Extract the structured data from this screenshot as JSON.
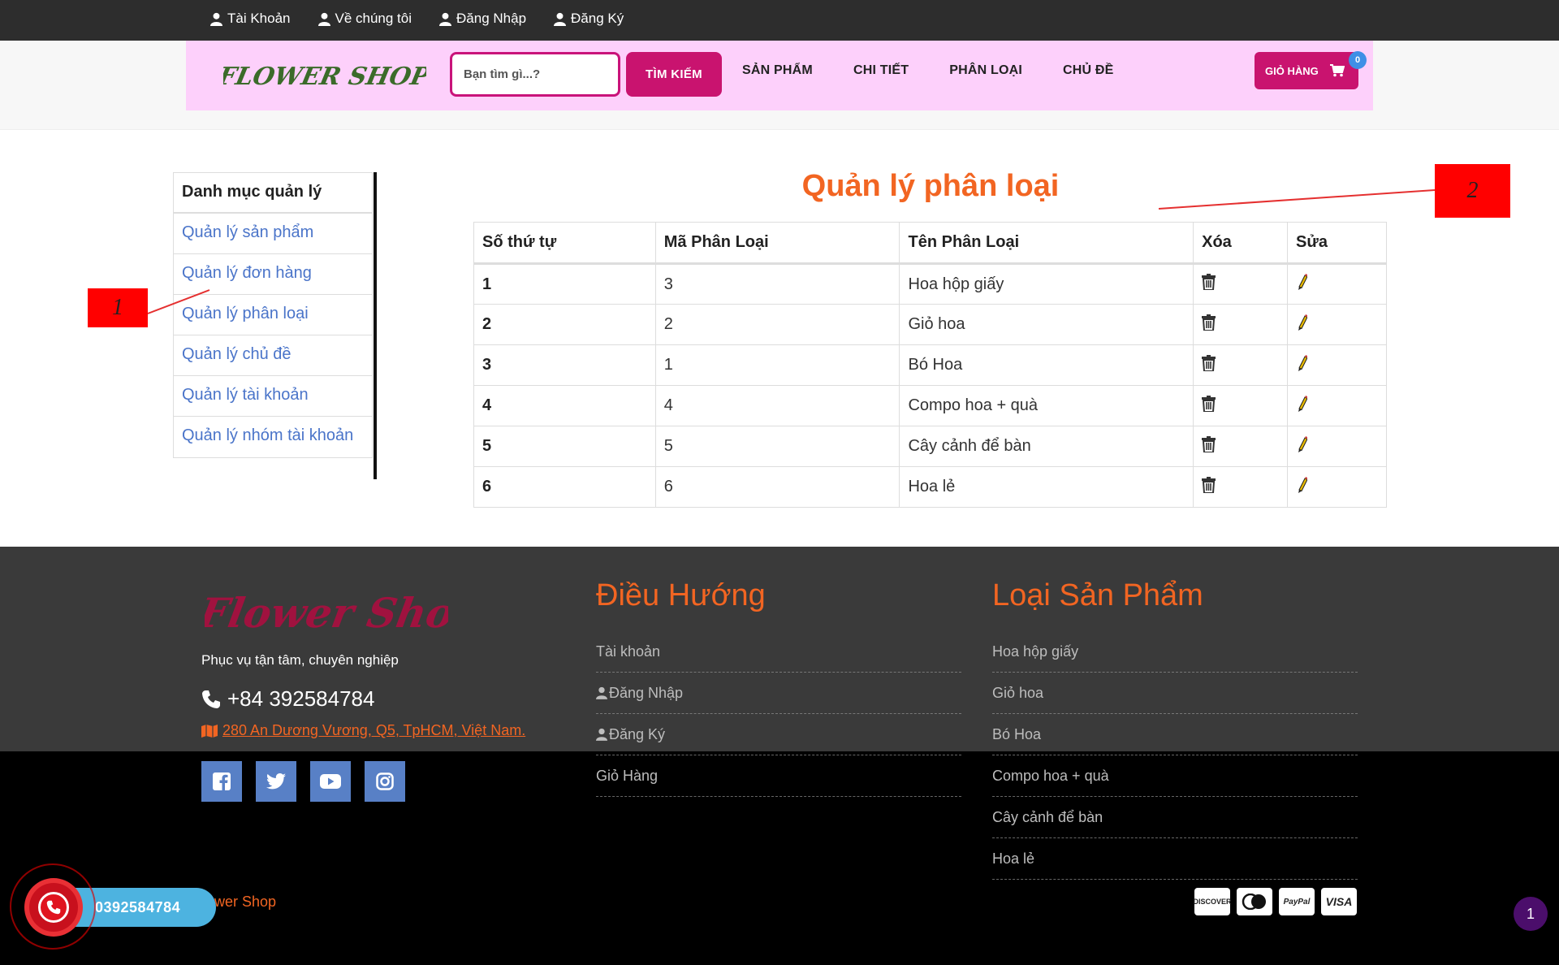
{
  "topbar": {
    "links": [
      {
        "label": "Tài Khoản",
        "icon": "user-icon"
      },
      {
        "label": "Về chúng tôi",
        "icon": "user-icon"
      },
      {
        "label": "Đăng Nhập",
        "icon": "user-icon"
      },
      {
        "label": "Đăng Ký",
        "icon": "user-icon"
      }
    ]
  },
  "header": {
    "logo_text": "FLOWER SHOP",
    "search_placeholder": "Bạn tìm gì...?",
    "search_button": "TÌM KIẾM",
    "nav": [
      "SẢN PHẨM",
      "CHI TIẾT",
      "PHÂN LOẠI",
      "CHỦ ĐỀ"
    ],
    "cart_label": "GIỎ HÀNG",
    "cart_count": "0"
  },
  "sidebar": {
    "title": "Danh mục quản lý",
    "items": [
      "Quản lý sản phẩm",
      "Quản lý đơn hàng",
      "Quản lý phân loại",
      "Quản lý chủ đề",
      "Quản lý tài khoản",
      "Quản lý nhóm tài khoản"
    ]
  },
  "annotations": {
    "tag1": "1",
    "tag2": "2"
  },
  "main": {
    "title": "Quản lý phân loại",
    "columns": [
      "Số thứ tự",
      "Mã Phân Loại",
      "Tên Phân Loại",
      "Xóa",
      "Sửa"
    ],
    "rows": [
      {
        "stt": "1",
        "code": "3",
        "name": "Hoa hộp giấy"
      },
      {
        "stt": "2",
        "code": "2",
        "name": "Giỏ hoa"
      },
      {
        "stt": "3",
        "code": "1",
        "name": "Bó Hoa"
      },
      {
        "stt": "4",
        "code": "4",
        "name": "Compo hoa + quà"
      },
      {
        "stt": "5",
        "code": "5",
        "name": "Cây cảnh để bàn"
      },
      {
        "stt": "6",
        "code": "6",
        "name": "Hoa lẻ"
      }
    ]
  },
  "footer": {
    "logo_text": "Flower Shop",
    "tagline": "Phục vụ tận tâm, chuyên nghiệp",
    "phone": "+84 392584784",
    "address": "280 An Dương Vương, Q5, TpHCM, Việt Nam.",
    "socials": [
      "facebook-icon",
      "twitter-icon",
      "youtube-icon",
      "instagram-icon"
    ],
    "nav_title": "Điều Hướng",
    "nav_links": [
      "Tài khoản",
      "Đăng Nhập",
      "Đăng Ký",
      "Giỏ Hàng"
    ],
    "cat_title": "Loại Sản Phẩm",
    "cat_links": [
      "Hoa hộp giấy",
      "Giỏ hoa",
      "Bó Hoa",
      "Compo hoa + quà",
      "Cây cảnh để bàn",
      "Hoa lẻ"
    ],
    "payments": [
      "DISCOVER",
      "mastercard",
      "PayPal",
      "VISA"
    ],
    "copyright": "ower Shop"
  },
  "call_widget": {
    "number": "0392584784"
  },
  "page_badge": "1",
  "colors": {
    "accent": "#c9136f",
    "orange": "#f26522",
    "header_pink": "#fdd0fb",
    "link_blue": "#4a74c9"
  }
}
